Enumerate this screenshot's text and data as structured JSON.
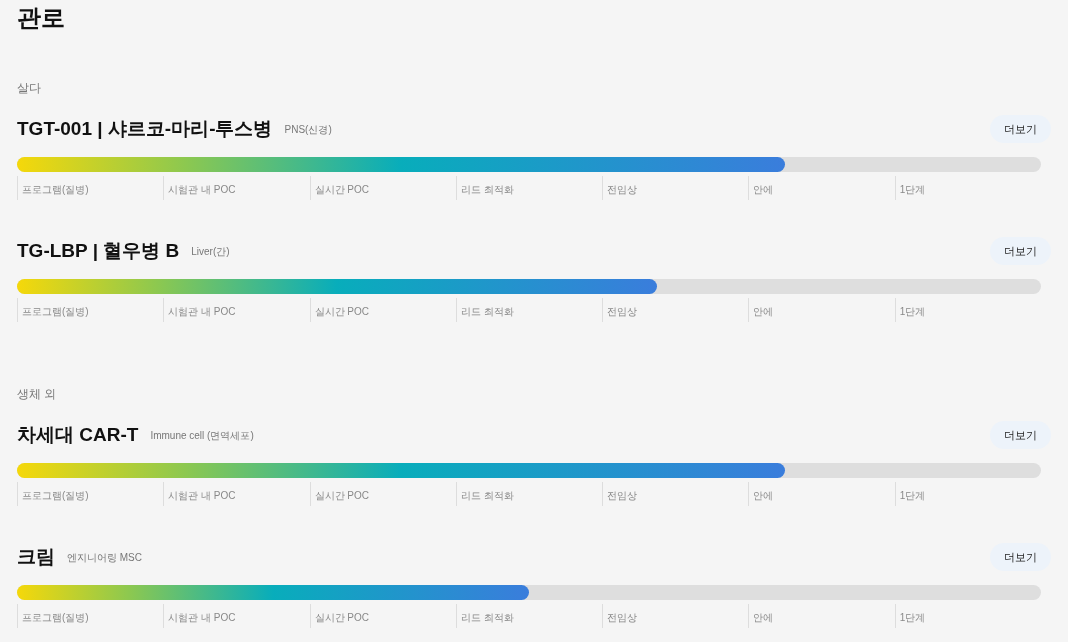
{
  "title": "관로",
  "sections": [
    {
      "label": "살다",
      "programs": [
        {
          "name": "TGT-001 | 샤르코-마리-투스병",
          "tag": "PNS(신경)",
          "button": "더보기",
          "level": 0.75,
          "stages": [
            "프로그램(질병)",
            "시험관 내 POC",
            "실시간 POC",
            "리드 최적화",
            "전임상",
            "안에",
            "1단계"
          ]
        },
        {
          "name": "TG-LBP | 혈우병 B",
          "tag": "Liver(간)",
          "button": "더보기",
          "level": 0.625,
          "stages": [
            "프로그램(질병)",
            "시험관 내 POC",
            "실시간 POC",
            "리드 최적화",
            "전임상",
            "안에",
            "1단계"
          ]
        }
      ]
    },
    {
      "label": "생체 외",
      "programs": [
        {
          "name": "차세대 CAR-T",
          "tag": "Immune cell (면역세포)",
          "button": "더보기",
          "level": 0.75,
          "stages": [
            "프로그램(질병)",
            "시험관 내 POC",
            "실시간 POC",
            "리드 최적화",
            "전임상",
            "안에",
            "1단계"
          ]
        },
        {
          "name": "크림",
          "tag": "엔지니어링 MSC",
          "button": "더보기",
          "level": 0.5,
          "stages": [
            "프로그램(질병)",
            "시험관 내 POC",
            "실시간 POC",
            "리드 최적화",
            "전임상",
            "안에",
            "1단계"
          ]
        }
      ]
    }
  ]
}
